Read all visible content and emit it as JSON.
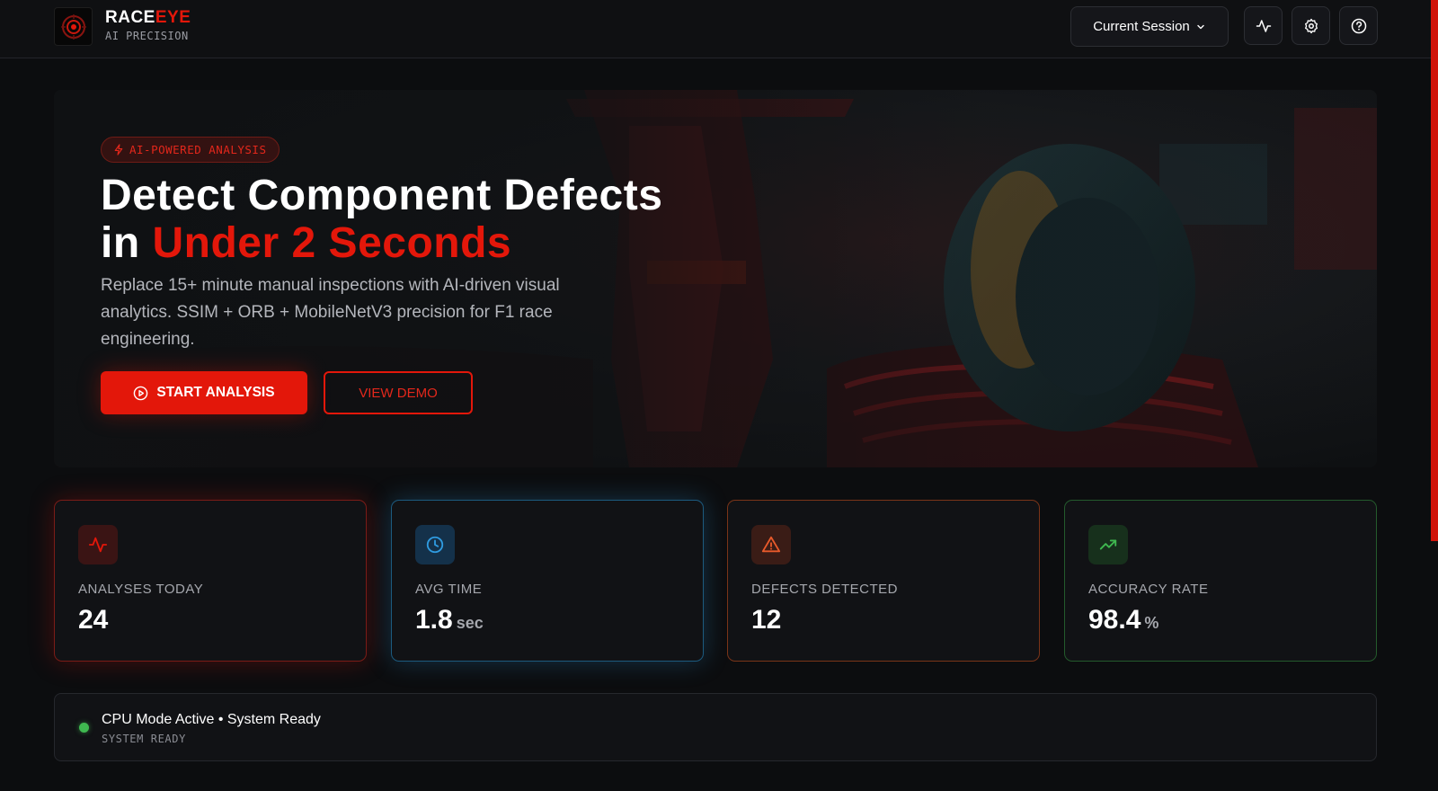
{
  "app": {
    "brand_part1": "RACE",
    "brand_part2": "EYE",
    "brand_subtitle": "AI PRECISION",
    "accent_color": "#e3170a"
  },
  "header": {
    "session_label": "Current Session",
    "icons": [
      "activity-icon",
      "gear-icon",
      "help-icon"
    ]
  },
  "hero": {
    "badge": "AI-POWERED ANALYSIS",
    "headline_line1": "Detect Component Defects",
    "headline_line2_prefix": "in ",
    "headline_line2_highlight": "Under 2 Seconds",
    "description": "Replace 15+ minute manual inspections with AI-driven visual analytics. SSIM + ORB + MobileNetV3 precision for F1 race engineering.",
    "primary_button": "START ANALYSIS",
    "secondary_button": "VIEW DEMO"
  },
  "stats": [
    {
      "label": "ANALYSES TODAY",
      "value": "24",
      "unit": "",
      "icon": "activity-icon",
      "color": "#e3170a"
    },
    {
      "label": "AVG TIME",
      "value": "1.8",
      "unit": "sec",
      "icon": "clock-icon",
      "color": "#2f9be0"
    },
    {
      "label": "DEFECTS DETECTED",
      "value": "12",
      "unit": "",
      "icon": "warning-icon",
      "color": "#e85a2b"
    },
    {
      "label": "ACCURACY RATE",
      "value": "98.4",
      "unit": "%",
      "icon": "trending-up-icon",
      "color": "#3fb950"
    }
  ],
  "status": {
    "main": "CPU Mode Active • System Ready",
    "sub": "SYSTEM READY",
    "color": "#3fb950"
  }
}
